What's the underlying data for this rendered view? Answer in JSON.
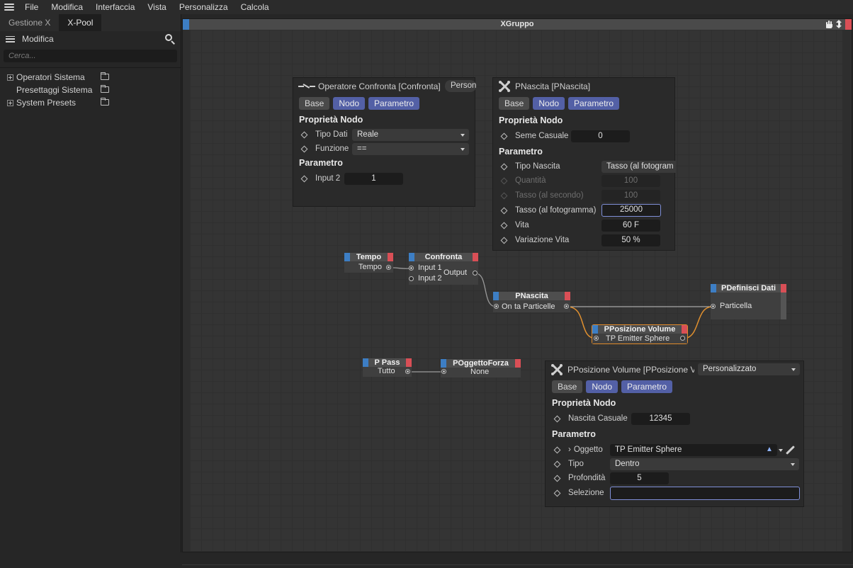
{
  "menu": [
    "File",
    "Modifica",
    "Interfaccia",
    "Vista",
    "Personalizza",
    "Calcola"
  ],
  "left_panel": {
    "tabs": [
      "Gestione X",
      "X-Pool"
    ],
    "active_tab": "X-Pool",
    "toolbar_label": "Modifica",
    "search_placeholder": "Cerca...",
    "tree": [
      {
        "label": "Operatori Sistema",
        "expandable": true
      },
      {
        "label": "Presettaggi Sistema",
        "expandable": false
      },
      {
        "label": "System Presets",
        "expandable": true
      }
    ]
  },
  "window": {
    "title": "XGruppo"
  },
  "nodes": {
    "tempo": {
      "title": "Tempo",
      "out": "Tempo"
    },
    "confronta": {
      "title": "Confronta",
      "in1": "Input 1",
      "in2": "Input 2",
      "out": "Output"
    },
    "pnascita": {
      "title": "PNascita",
      "in": "On",
      "out": "ta Particelle"
    },
    "pdefinisci": {
      "title": "PDefinisci Dati",
      "in": "Particella"
    },
    "pposizione": {
      "title": "PPosizione Volume",
      "out": "TP Emitter Sphere"
    },
    "ppass": {
      "title": "P Pass",
      "out": "Tutto"
    },
    "poggetto": {
      "title": "POggettoForza",
      "in": "None"
    }
  },
  "panel_confronta": {
    "title": "Operatore Confronta [Confronta]",
    "tag": "Person",
    "tabs": [
      "Base",
      "Nodo",
      "Parametro"
    ],
    "section1": "Proprietà Nodo",
    "rows1": [
      {
        "label": "Tipo Dati",
        "value": "Reale"
      },
      {
        "label": "Funzione",
        "value": "=="
      }
    ],
    "section2": "Parametro",
    "rows2": [
      {
        "label": "Input 2",
        "value": "1"
      }
    ]
  },
  "panel_pnascita": {
    "title": "PNascita [PNascita]",
    "tabs": [
      "Base",
      "Nodo",
      "Parametro"
    ],
    "section1": "Proprietà Nodo",
    "seed_label": "Seme Casuale",
    "seed_value": "0",
    "section2": "Parametro",
    "rows": [
      {
        "label": "Tipo Nascita",
        "value": "Tasso (al fotogram"
      },
      {
        "label": "Quantità",
        "value": "100"
      },
      {
        "label": "Tasso (al secondo)",
        "value": "100"
      },
      {
        "label": "Tasso (al fotogramma)",
        "value": "25000"
      },
      {
        "label": "Vita",
        "value": "60 F"
      },
      {
        "label": "Variazione Vita",
        "value": "50 %"
      }
    ]
  },
  "panel_pposizione": {
    "title": "PPosizione Volume [PPosizione Vo",
    "preset": "Personalizzato",
    "tabs": [
      "Base",
      "Nodo",
      "Parametro"
    ],
    "section1": "Proprietà Nodo",
    "seed_label": "Nascita Casuale",
    "seed_value": "12345",
    "section2": "Parametro",
    "oggetto_label": "Oggetto",
    "oggetto_value": "TP Emitter Sphere",
    "tipo_label": "Tipo",
    "tipo_value": "Dentro",
    "prof_label": "Profondità",
    "prof_value": "5",
    "sel_label": "Selezione",
    "sel_value": ""
  },
  "colors": {
    "accent_blue": "#5360a6",
    "node_left_cap": "#3d7ec4",
    "node_right_cap": "#d94f56",
    "selection": "#e08a2a",
    "wire_orange": "#e0902f"
  }
}
